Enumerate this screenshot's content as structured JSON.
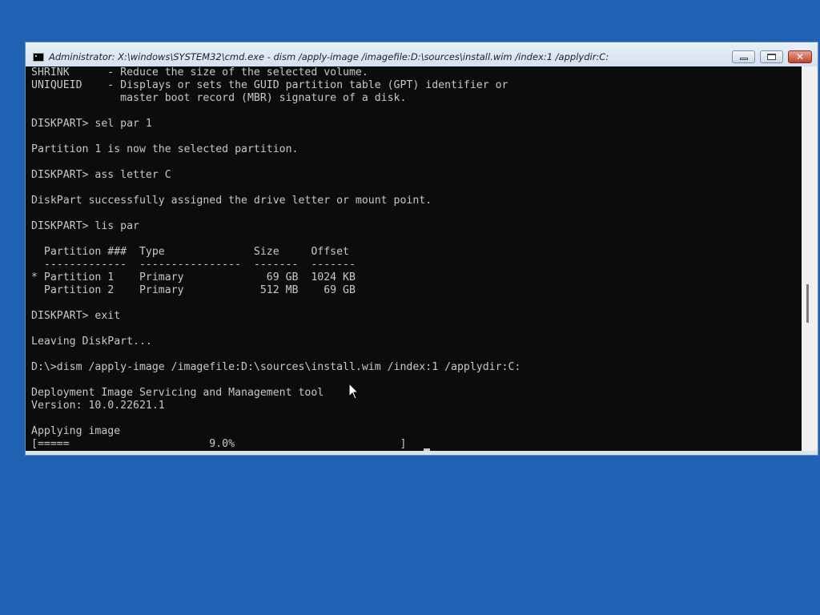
{
  "window": {
    "title": "Administrator: X:\\windows\\SYSTEM32\\cmd.exe - dism  /apply-image /imagefile:D:\\sources\\install.wim /index:1 /applydir:C:",
    "buttons": {
      "minimize_icon": "minimize-icon",
      "maximize_icon": "restore-icon",
      "close_icon": "close-icon",
      "close_glyph": "✕"
    }
  },
  "console": {
    "lines": [
      "SHRINK      - Reduce the size of the selected volume.",
      "UNIQUEID    - Displays or sets the GUID partition table (GPT) identifier or",
      "              master boot record (MBR) signature of a disk.",
      "",
      "DISKPART> sel par 1",
      "",
      "Partition 1 is now the selected partition.",
      "",
      "DISKPART> ass letter C",
      "",
      "DiskPart successfully assigned the drive letter or mount point.",
      "",
      "DISKPART> lis par",
      "",
      "  Partition ###  Type              Size     Offset",
      "  -------------  ----------------  -------  -------",
      "* Partition 1    Primary             69 GB  1024 KB",
      "  Partition 2    Primary            512 MB    69 GB",
      "",
      "DISKPART> exit",
      "",
      "Leaving DiskPart...",
      "",
      "D:\\>dism /apply-image /imagefile:D:\\sources\\install.wim /index:1 /applydir:C:",
      "",
      "Deployment Image Servicing and Management tool",
      "Version: 10.0.22621.1",
      "",
      "Applying image",
      "[=====                      9.0%                          ]"
    ],
    "progress_percent": 9.0,
    "text_color": "#c8c8c8",
    "background_color": "#0c0c0c"
  },
  "desktop": {
    "background_color": "#1f62b3"
  }
}
